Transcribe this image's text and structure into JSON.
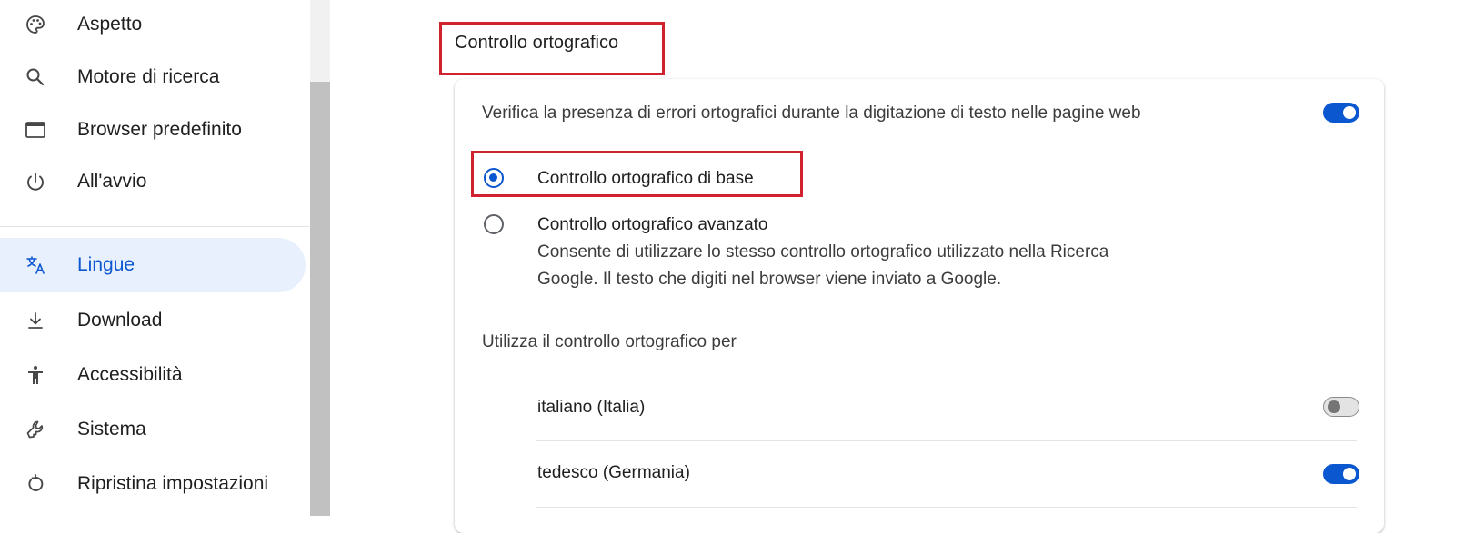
{
  "sidebar": {
    "items": [
      {
        "label": "Aspetto",
        "icon": "palette-icon"
      },
      {
        "label": "Motore di ricerca",
        "icon": "search-icon"
      },
      {
        "label": "Browser predefinito",
        "icon": "browser-window-icon"
      },
      {
        "label": "All'avvio",
        "icon": "power-icon"
      },
      {
        "label": "Lingue",
        "icon": "translate-icon",
        "active": true
      },
      {
        "label": "Download",
        "icon": "download-icon"
      },
      {
        "label": "Accessibilità",
        "icon": "accessibility-icon"
      },
      {
        "label": "Sistema",
        "icon": "wrench-icon"
      },
      {
        "label": "Ripristina impostazioni",
        "icon": "reset-icon"
      }
    ]
  },
  "spellcheck": {
    "title": "Controllo ortografico",
    "description": "Verifica la presenza di errori ortografici durante la digitazione di testo nelle pagine web",
    "enabled": true,
    "options": [
      {
        "label": "Controllo ortografico di base",
        "selected": true
      },
      {
        "label": "Controllo ortografico avanzato",
        "selected": false,
        "sub_line1": "Consente di utilizzare lo stesso controllo ortografico utilizzato nella Ricerca",
        "sub_line2": "Google. Il testo che digiti nel browser viene inviato a Google."
      }
    ],
    "languages_heading": "Utilizza il controllo ortografico per",
    "languages": [
      {
        "label": "italiano (Italia)",
        "enabled": false
      },
      {
        "label": "tedesco (Germania)",
        "enabled": true
      }
    ]
  },
  "colors": {
    "accent": "#0b57d0",
    "active_nav_bg": "#e8f0fe",
    "highlight_box": "#d3222f"
  }
}
